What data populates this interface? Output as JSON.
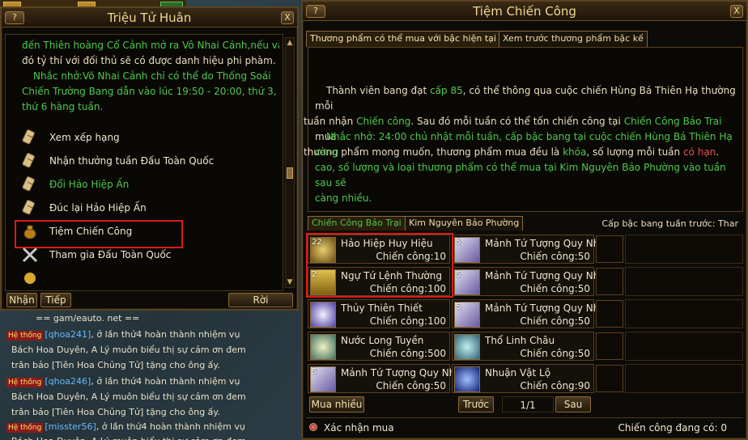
{
  "colors": {
    "accent_green": "#4ec84e",
    "highlight_red": "#e01818",
    "panel_gold": "#f0d890"
  },
  "left_panel": {
    "title": "Triệu Tử Huân",
    "help_label": "?",
    "close_label": "X",
    "paragraph1_line1": "đến Thiên hoàng Cổ Cảnh mở ra Vô Nhai Cảnh,nếu vào",
    "paragraph1_line2": "đó tỷ thí với đối thủ sẽ có được danh hiệu phi phàm.",
    "reminder_line1": "Nhắc nhở:Võ Nhai Cảnh chỉ có thể do Thống Soái",
    "reminder_line2": "Chiến Trường Bang dẫn vào lúc 19:50 - 20:00, thứ 3,",
    "reminder_line3": "thứ 6 hàng tuần.",
    "menu": [
      {
        "label": "Xem xếp hạng",
        "icon": "scroll-icon"
      },
      {
        "label": "Nhận thưởng tuần Đấu Toàn Quốc",
        "icon": "scroll-icon"
      },
      {
        "label": "Đổi Hảo Hiệp Ấn",
        "icon": "scroll-icon"
      },
      {
        "label": "Đúc lại Hảo Hiệp Ấn",
        "icon": "scroll-icon"
      },
      {
        "label": "Tiệm Chiến Công",
        "icon": "money-bag-icon"
      },
      {
        "label": "Tham gia Đấu Toàn Quốc",
        "icon": "crossed-swords-icon"
      }
    ],
    "footer": {
      "tab1": "Nhận",
      "tab2": "Tiếp",
      "close": "Rời"
    }
  },
  "chat": {
    "header": "== gam/eauto. net ==",
    "tag": "Hệ thống",
    "lines": [
      {
        "name": "[qhoa241]",
        "text": ", ở lần thứ4 hoàn thành nhiệm vụ"
      },
      {
        "text": "Bách Hoa Duyên, A Lý muôn biểu thị sự cảm ơn đem"
      },
      {
        "text": "trân bảo [Tiên Hoa Chủng Tử] tặng cho ông ấy."
      },
      {
        "name": "[qhoa246]",
        "text": ", ở lần thứ4 hoàn thành nhiệm vụ"
      },
      {
        "text": "Bách Hoa Duyên, A Lý muôn biểu thị sự cảm ơn đem"
      },
      {
        "text": "trân bảo [Tiên Hoa Chủng Tử] tặng cho ông ấy."
      },
      {
        "name": "[misster56]",
        "text": ", ở lần thứ4 hoàn thành nhiệm vụ"
      },
      {
        "text": "Bách Hoa Duyên, A Lý muôn biểu thị sự cảm ơn đem"
      }
    ]
  },
  "right_panel": {
    "title": "Tiệm Chiến Công",
    "help_label": "?",
    "close_label": "X",
    "tabs": [
      "Thương phẩm có thể mua với bậc hiện tại",
      "Xem trước thương phẩm bậc kế"
    ],
    "info": {
      "p1_a": "Thành viên bang đạt ",
      "p1_level": "cấp 85",
      "p1_b": ", có thể thông qua cuộc chiến Hùng Bá Thiên Hạ thường mỗi",
      "p1_c": "tuần nhận ",
      "p1_cc": "Chiến công",
      "p1_d": ". Sau đó mỗi tuần có thể tốn chiến công tại ",
      "p1_shop": "Chiến Công Bảo Trai",
      "p1_e": " mua",
      "p1_f": "thương phẩm mong muốn, thương phẩm mua đều là ",
      "p1_lock": "khóa",
      "p1_g": ", số lượng mỗi tuần ",
      "p1_limit": "có hạn",
      "p1_h": ".",
      "p2_1": "Nhắc nhở:  24:00 chủ nhật mỗi tuần, cấp bậc bang tại cuộc chiến Hùng Bá Thiên Hạ càng",
      "p2_2": "cao, số lượng và loại thương phẩm có thể mua tại Kim Nguyên Bảo Phường vào tuần sau sẽ",
      "p2_3": "càng nhiều."
    },
    "subtabs": [
      "Chiến Công Bảo Trại",
      "Kim Nguyên Bảo Phường"
    ],
    "rank_label": "Cấp bậc bang tuần trước: Thar",
    "items_left": [
      {
        "qty": "22",
        "name": "Hảo Hiệp Huy Hiệu",
        "price": "Chiến công:10",
        "icon": "badge-icon"
      },
      {
        "qty": "2",
        "name": "Ngự Tứ Lệnh Thường",
        "price": "Chiến công:100",
        "icon": "token-icon"
      },
      {
        "qty": "",
        "name": "Thủy Thiên Thiết",
        "price": "Chiến công:100",
        "icon": "crystal-icon"
      },
      {
        "qty": "",
        "name": "Nước Long Tuyền",
        "price": "Chiến công:500",
        "icon": "bowl-icon"
      },
      {
        "qty": "5",
        "name": "Mảnh Tứ Tượng Quy Nh",
        "price": "Chiến công:50",
        "icon": "fragment-icon"
      }
    ],
    "items_right": [
      {
        "qty": "5",
        "name": "Mảnh Tứ Tượng Quy Nh",
        "price": "Chiến công:50",
        "icon": "fragment-icon"
      },
      {
        "qty": "5",
        "name": "Mảnh Tứ Tượng Quy Nh",
        "price": "Chiến công:50",
        "icon": "fragment-icon"
      },
      {
        "qty": "5",
        "name": "Mảnh Tứ Tượng Quy Nh",
        "price": "Chiến công:50",
        "icon": "fragment-icon"
      },
      {
        "qty": "",
        "name": "Thổ Linh Châu",
        "price": "Chiến công:50",
        "icon": "orb-icon"
      },
      {
        "qty": "",
        "name": "Nhuận Vật Lộ",
        "price": "Chiến công:90",
        "icon": "flame-icon"
      }
    ],
    "buy_many": "Mua nhiều",
    "prev": "Trước",
    "page": "1/1",
    "next": "Sau",
    "confirm_label": "Xác nhận mua",
    "points_label": "Chiến công đang có: 0"
  }
}
